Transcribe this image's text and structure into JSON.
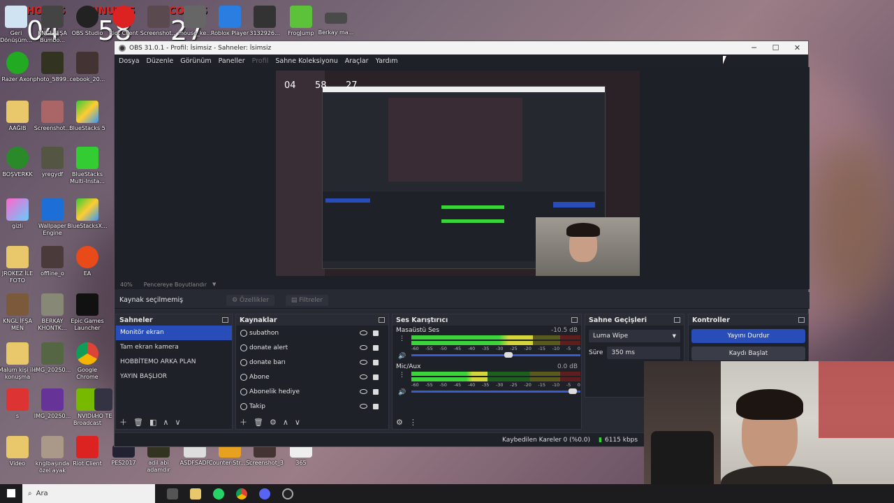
{
  "timer": {
    "hours_label": "HOURS",
    "minutes_label": "MINUTES",
    "seconds_label": "SECONDS",
    "hours": "04",
    "minutes": "58",
    "seconds": "27"
  },
  "desktop_icons": [
    {
      "label": "Geri Dönüşüm..."
    },
    {
      "label": "KNGL İFŞA Bumbo..."
    },
    {
      "label": "OBS Studio"
    },
    {
      "label": "Riot Client"
    },
    {
      "label": "Screenshot..."
    },
    {
      "label": "mouse_ke..."
    },
    {
      "label": "Roblox Player"
    },
    {
      "label": "3132926..."
    },
    {
      "label": "FrogJump"
    },
    {
      "label": "Berkay ma..."
    },
    {
      "label": "Razer Axon"
    },
    {
      "label": "photo_5899..."
    },
    {
      "label": "cebook_20..."
    },
    {
      "label": "AAĞIB"
    },
    {
      "label": "Screenshot..."
    },
    {
      "label": "BlueStacks 5"
    },
    {
      "label": "BOŞVERKK"
    },
    {
      "label": "yregydf"
    },
    {
      "label": "BlueStacks Multi-Insta..."
    },
    {
      "label": "gizli"
    },
    {
      "label": "Wallpaper Engine"
    },
    {
      "label": "BlueStacksX..."
    },
    {
      "label": "JROKEZ İLE FOTO"
    },
    {
      "label": "offline_o"
    },
    {
      "label": "EA"
    },
    {
      "label": "KNGL İFŞA MEN"
    },
    {
      "label": "BERKAY KHONTK..."
    },
    {
      "label": "Epic Games Launcher"
    },
    {
      "label": "Malum kişi ile konuşma"
    },
    {
      "label": "IMG_20250..."
    },
    {
      "label": "Google Chrome"
    },
    {
      "label": "s"
    },
    {
      "label": "IMG_20250..."
    },
    {
      "label": "NVIDIA Broadcast"
    },
    {
      "label": "HO TE"
    },
    {
      "label": "Video"
    },
    {
      "label": "knglbaşında özel ayak"
    },
    {
      "label": "Riot Client"
    },
    {
      "label": "PES2017"
    },
    {
      "label": "adil abi adamdır"
    },
    {
      "label": "ASDFSADF"
    },
    {
      "label": "Counter-Str... 2"
    },
    {
      "label": "Screenshot_3"
    },
    {
      "label": "365"
    }
  ],
  "obs": {
    "title": "OBS 31.0.1 - Profil: İsimsiz - Sahneler: İsimsiz",
    "window_buttons": {
      "minimize": "─",
      "maximize": "☐",
      "close": "✕"
    },
    "menu": [
      "Dosya",
      "Düzenle",
      "Görünüm",
      "Paneller",
      "Profil",
      "Sahne Koleksiyonu",
      "Araçlar",
      "Yardım"
    ],
    "zoom": "40%",
    "zoom_mode": "Pencereye Boyutlandır",
    "no_source": "Kaynak seçilmemiş",
    "properties_btn": "Özellikler",
    "filters_btn": "Filtreler",
    "scenes": {
      "title": "Sahneler",
      "items": [
        "Monitör ekran",
        "Tam ekran kamera",
        "HOBBİTEMO ARKA PLAN",
        "YAYIN BAŞLIOR"
      ]
    },
    "sources": {
      "title": "Kaynaklar",
      "items": [
        "subathon",
        "donate alert",
        "donate barı",
        "Abone",
        "Abonelik hediye",
        "Takip"
      ]
    },
    "mixer": {
      "title": "Ses Karıştırıcı",
      "channels": [
        {
          "name": "Masaüstü Ses",
          "db": "-10.5 dB",
          "level": 0.72,
          "volume": 0.6
        },
        {
          "name": "Mic/Aux",
          "db": "0.0 dB",
          "level": 0.45,
          "volume": 0.98
        }
      ],
      "scale": [
        "-60",
        "-55",
        "-50",
        "-45",
        "-40",
        "-35",
        "-30",
        "-25",
        "-20",
        "-15",
        "-10",
        "-5",
        "0"
      ]
    },
    "transitions": {
      "title": "Sahne Geçişleri",
      "type": "Luma Wipe",
      "duration_label": "Süre",
      "duration": "350 ms"
    },
    "controls": {
      "title": "Kontroller",
      "stream_btn": "Yayını Durdur",
      "record_btn": "Kaydı Başlat"
    },
    "status": {
      "dropped": "Kaybedilen Kareler 0 (%0.0)",
      "bitrate": "6115 kbps"
    }
  },
  "taskbar": {
    "search": "Ara"
  }
}
